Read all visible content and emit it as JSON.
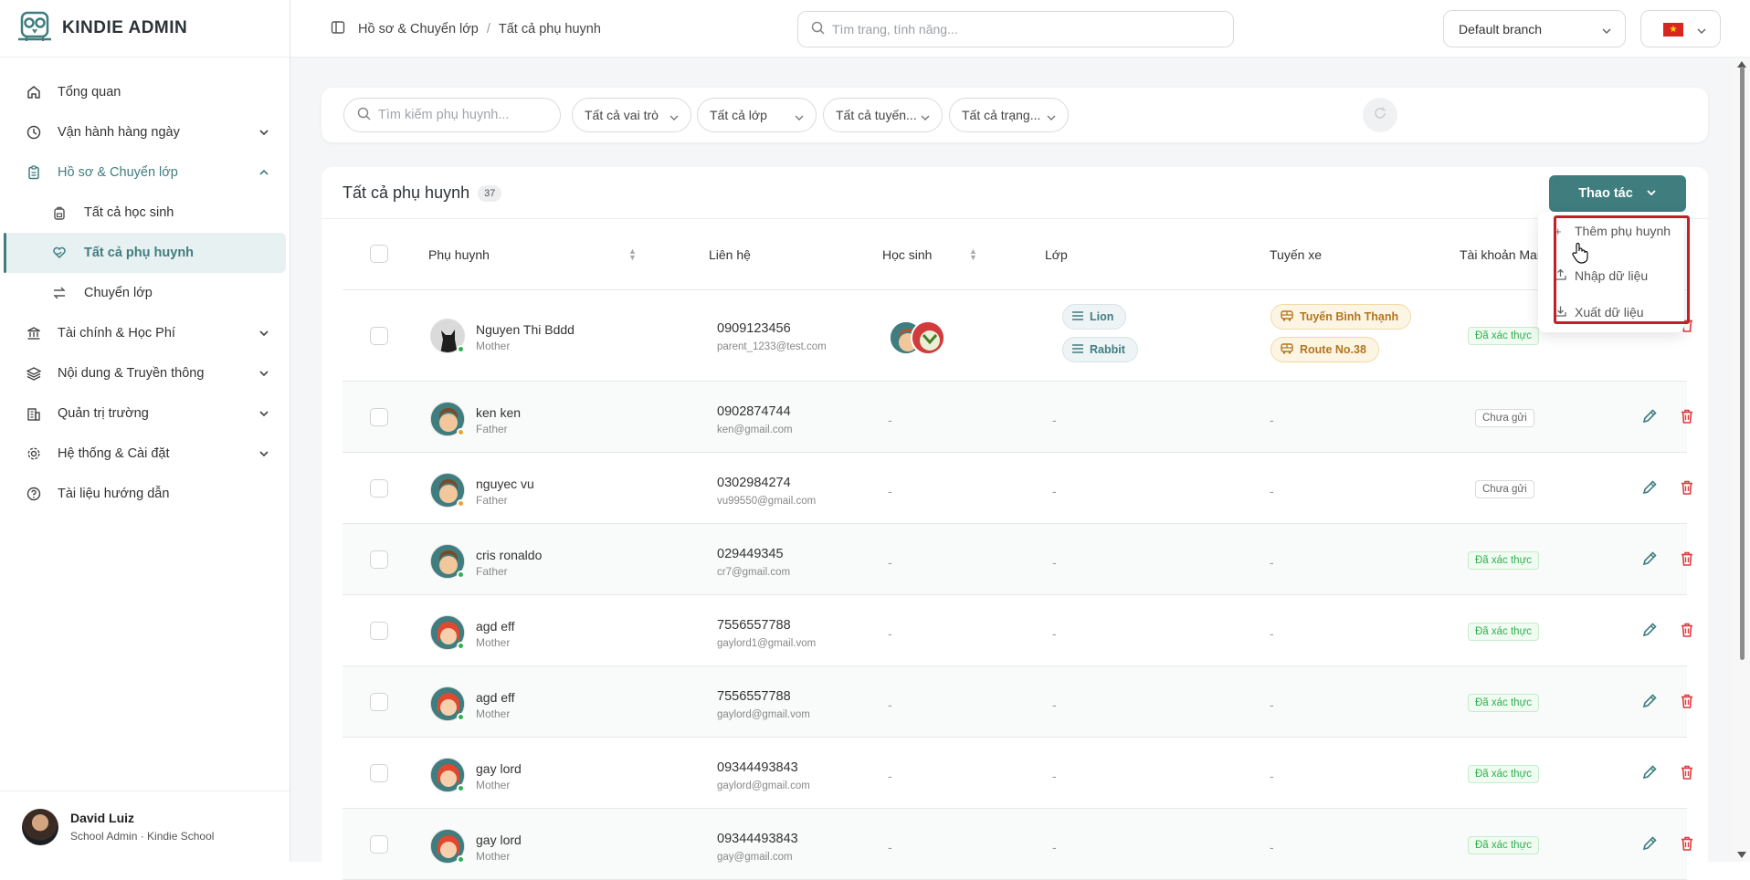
{
  "app": {
    "title": "KINDIE ADMIN"
  },
  "sidebar": {
    "items": [
      {
        "label": "Tổng quan",
        "icon": "home-icon"
      },
      {
        "label": "Vận hành hàng ngày",
        "icon": "clock-icon"
      },
      {
        "label": "Hồ sơ & Chuyển lớp",
        "icon": "clipboard-icon"
      },
      {
        "label": "Tài chính & Học Phí",
        "icon": "bank-icon"
      },
      {
        "label": "Nội dung & Truyền thông",
        "icon": "layers-icon"
      },
      {
        "label": "Quản trị trường",
        "icon": "building-icon"
      },
      {
        "label": "Hệ thống & Cài đặt",
        "icon": "gear-icon"
      },
      {
        "label": "Tài liệu hướng dẫn",
        "icon": "help-icon"
      }
    ],
    "subitems": [
      {
        "label": "Tất cả học sinh",
        "icon": "backpack-icon"
      },
      {
        "label": "Tất cả phụ huynh",
        "icon": "heart-hand-icon"
      },
      {
        "label": "Chuyển lớp",
        "icon": "swap-icon"
      }
    ],
    "user": {
      "name": "David Luiz",
      "role": "School Admin · Kindie School"
    }
  },
  "topbar": {
    "breadcrumb": [
      "Hồ sơ & Chuyển lớp",
      "Tất cả phụ huynh"
    ],
    "search_placeholder": "Tìm trang, tính năng...",
    "branch": "Default branch"
  },
  "filters": {
    "search_placeholder": "Tìm kiếm phụ huynh...",
    "role": "Tất cả vai trò",
    "class": "Tất cả lớp",
    "route": "Tất cả tuyến...",
    "status": "Tất cả trạng..."
  },
  "panel": {
    "title": "Tất cả phụ huynh",
    "count": "37",
    "action_label": "Thao tác",
    "columns": [
      "Phụ huynh",
      "Liên hệ",
      "Học sinh",
      "Lớp",
      "Tuyến xe",
      "Tài khoản Mail"
    ]
  },
  "dropdown": {
    "items": [
      {
        "label": "Thêm phụ huynh",
        "icon": "plus-icon"
      },
      {
        "label": "Nhập dữ liệu",
        "icon": "upload-icon"
      },
      {
        "label": "Xuất dữ liệu",
        "icon": "download-icon"
      }
    ]
  },
  "rows": [
    {
      "name": "Nguyen Thi Bddd",
      "role": "Mother",
      "phone": "0909123456",
      "email": "parent_1233@test.com",
      "student": "",
      "class": [
        "Lion",
        "Rabbit"
      ],
      "route": [
        "Tuyến Bình Thạnh",
        "Route No.38"
      ],
      "mail": "Đã xác thực"
    },
    {
      "name": "ken ken",
      "role": "Father",
      "phone": "0902874744",
      "email": "ken@gmail.com",
      "student": "-",
      "class": [
        "-"
      ],
      "route": [
        "-"
      ],
      "mail": "Chưa gửi"
    },
    {
      "name": "nguyec vu",
      "role": "Father",
      "phone": "0302984274",
      "email": "vu99550@gmail.com",
      "student": "-",
      "class": [
        "-"
      ],
      "route": [
        "-"
      ],
      "mail": "Chưa gửi"
    },
    {
      "name": "cris ronaldo",
      "role": "Father",
      "phone": "029449345",
      "email": "cr7@gmail.com",
      "student": "-",
      "class": [
        "-"
      ],
      "route": [
        "-"
      ],
      "mail": "Đã xác thực"
    },
    {
      "name": "agd eff",
      "role": "Mother",
      "phone": "7556557788",
      "email": "gaylord1@gmail.vom",
      "student": "-",
      "class": [
        "-"
      ],
      "route": [
        "-"
      ],
      "mail": "Đã xác thực"
    },
    {
      "name": "agd eff",
      "role": "Mother",
      "phone": "7556557788",
      "email": "gaylord@gmail.vom",
      "student": "-",
      "class": [
        "-"
      ],
      "route": [
        "-"
      ],
      "mail": "Đã xác thực"
    },
    {
      "name": "gay lord",
      "role": "Mother",
      "phone": "09344493843",
      "email": "gaylord@gmail.com",
      "student": "-",
      "class": [
        "-"
      ],
      "route": [
        "-"
      ],
      "mail": "Đã xác thực"
    },
    {
      "name": "gay lord",
      "role": "Mother",
      "phone": "09344493843",
      "email": "gay@gmail.com",
      "student": "-",
      "class": [
        "-"
      ],
      "route": [
        "-"
      ],
      "mail": "Đã xác thực"
    }
  ],
  "colors": {
    "accent": "#3f7d7f",
    "verified": "#2eb14e",
    "danger": "#e0393e",
    "highlight": "#c11f2a"
  }
}
